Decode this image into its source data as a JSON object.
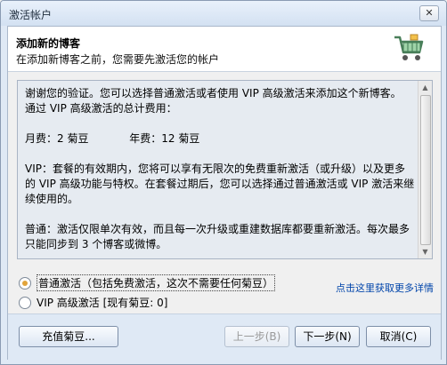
{
  "window": {
    "title": "激活帐户",
    "close_glyph": "✕"
  },
  "header": {
    "title": "添加新的博客",
    "subtitle": "在添加新博客之前，您需要先激活您的帐户",
    "icon": "shopping-cart-icon"
  },
  "info": {
    "line1": "谢谢您的验证。您可以选择普通激活或者使用 VIP 高级激活来添加这个新博客。",
    "line2": "通过 VIP 高级激活的总计费用：",
    "monthly_fee": "月费：2 菊豆",
    "yearly_fee": "年费：12 菊豆",
    "vip_desc": "VIP：套餐的有效期内，您将可以享有无限次的免费重新激活（或升级）以及更多的 VIP 高级功能与特权。在套餐过期后，您可以选择通过普通激活或 VIP 激活来继续使用的。",
    "normal_desc": "普通：激活仅限单次有效，而且每一次升级或重建数据库都要重新激活。每次最多只能同步到 3 个博客或微博。"
  },
  "options": {
    "normal_label": "普通激活（包括免费激活，这次不需要任何菊豆）",
    "vip_label": "VIP 高级激活 [现有菊豆: 0]",
    "selected": "normal"
  },
  "link": {
    "label": "点击这里获取更多详情"
  },
  "buttons": {
    "recharge": "充值菊豆...",
    "back": "上一步(B)",
    "next": "下一步(N)",
    "cancel": "取消(C)"
  },
  "colors": {
    "accent_radio": "#e1a43b",
    "link": "#0044aa",
    "chrome": "#dfe9f5"
  }
}
